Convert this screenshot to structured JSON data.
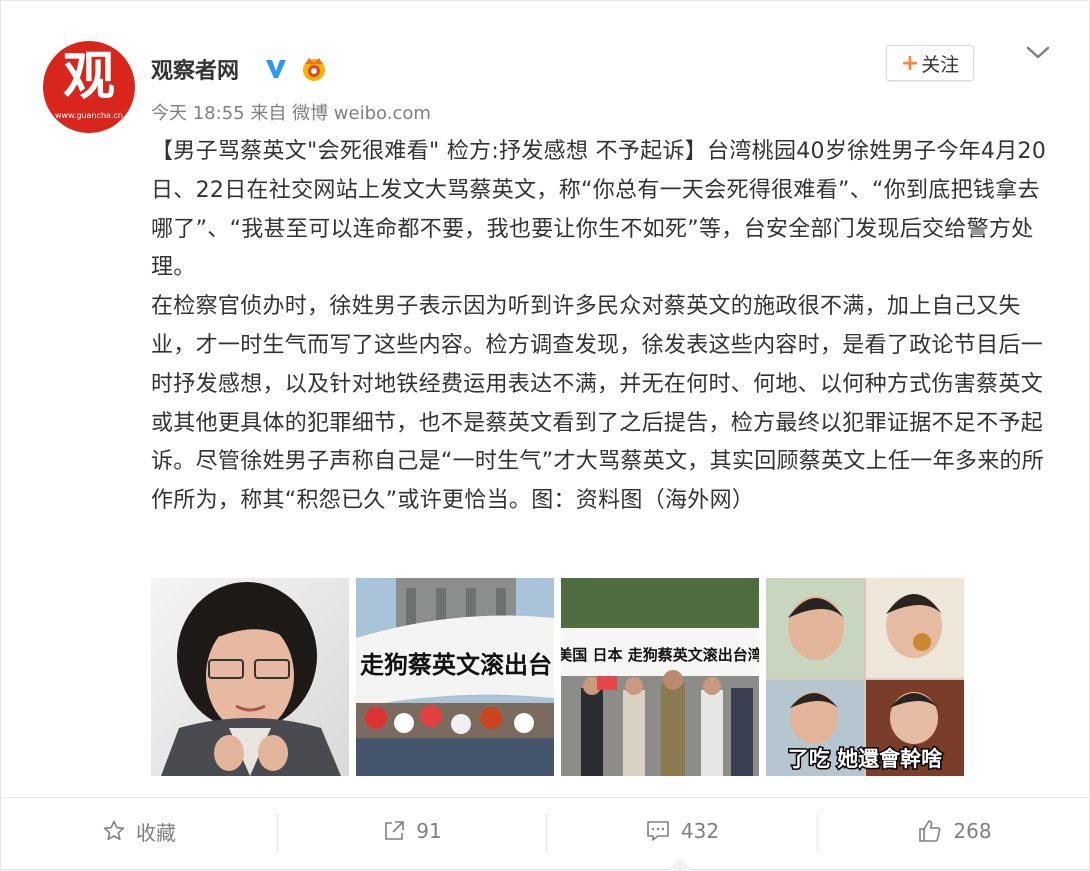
{
  "post": {
    "author": "观察者网",
    "avatar_glyph": "观",
    "avatar_site": "www.guancha.cn",
    "time": "今天 18:55",
    "source_prefix": "来自",
    "source": "微博 weibo.com",
    "follow_label": "关注",
    "follow_plus": "+",
    "paragraphs": [
      "【男子骂蔡英文\"会死很难看\" 检方:抒发感想 不予起诉】台湾桃园40岁徐姓男子今年4月20日、22日在社交网站上发文大骂蔡英文，称“你总有一天会死得很难看”、“你到底把钱拿去哪了”、“我甚至可以连命都不要，我也要让你生不如死”等，台安全部门发现后交给警方处理。",
      "在检察官侦办时，徐姓男子表示因为听到许多民众对蔡英文的施政很不满，加上自己又失业，才一时生气而写了这些内容。检方调查发现，徐发表这些内容时，是看了政论节目后一时抒发感想，以及针对地铁经费运用表达不满，并无在何时、何地、以何种方式伤害蔡英文或其他更具体的犯罪细节，也不是蔡英文看到了之后提告，检方最终以犯罪证据不足不予起诉。尽管徐姓男子声称自己是“一时生气”才大骂蔡英文，其实回顾蔡英文上任一年多来的所作所为，称其“积怨已久”或许更恰当。图：资料图（海外网）"
    ],
    "images": [
      {
        "caption": ""
      },
      {
        "banner": "走狗蔡英文滚出台"
      },
      {
        "banner": "美国 日本 走狗蔡英文滚出台湾"
      },
      {
        "overlay": "了吃 她還會幹啥"
      }
    ]
  },
  "actions": {
    "favorite_label": "收藏",
    "repost_count": "91",
    "comment_count": "432",
    "like_count": "268"
  },
  "colors": {
    "accent": "#ff8140",
    "avatar_bg": "#d8261c",
    "verified": "#2a9bf0",
    "muted": "#808080"
  }
}
